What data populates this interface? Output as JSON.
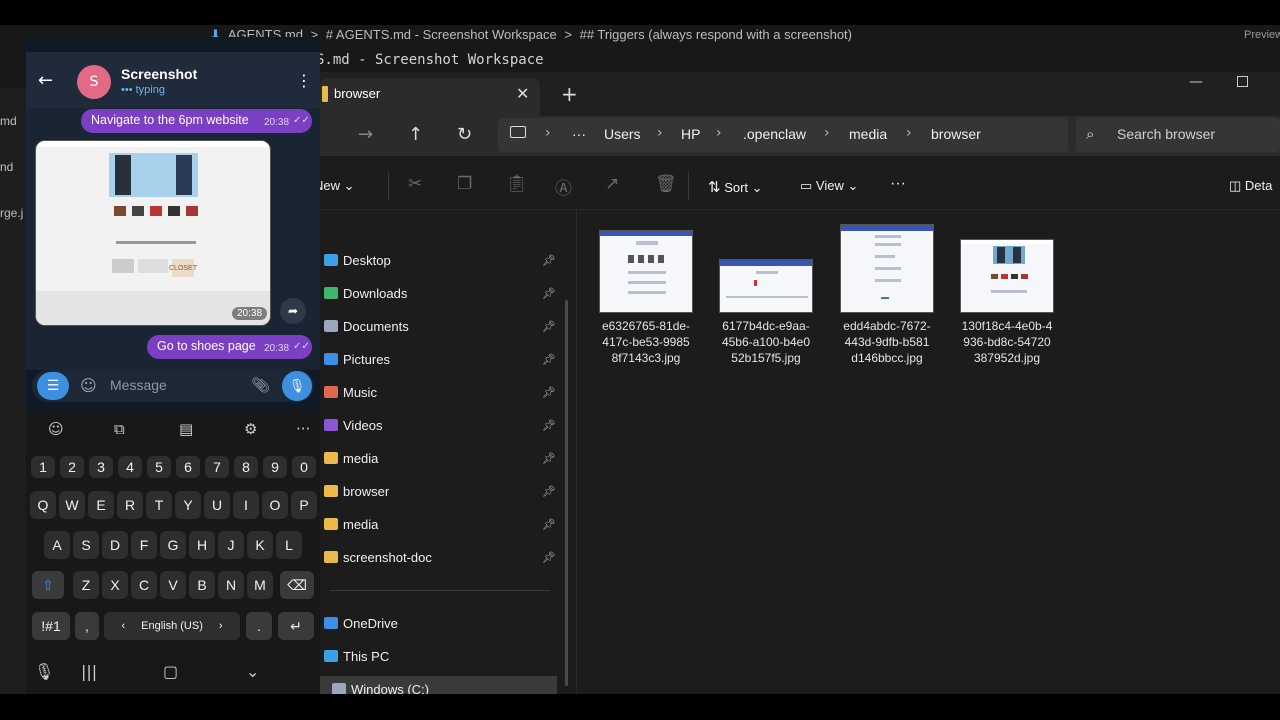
{
  "editor": {
    "breadcrumb": [
      "AGENTS.md",
      ">",
      "# AGENTS.md - Screenshot Workspace",
      ">",
      "## Triggers (always respond with a screenshot)"
    ],
    "preview_label": "Preview",
    "line": "S.md - Screenshot Workspace",
    "left_items": [
      "md",
      "nd",
      "rge.j"
    ]
  },
  "explorer": {
    "tab_title": "browser",
    "path": [
      "Users",
      "HP",
      ".openclaw",
      "media",
      "browser"
    ],
    "search_placeholder": "Search browser",
    "toolbar": {
      "new": "New",
      "sort": "Sort",
      "view": "View",
      "details": "Deta"
    },
    "sidebar": [
      {
        "label": "Desktop",
        "icon": "desktop-icon",
        "color": "#3aa0e8",
        "pinned": true
      },
      {
        "label": "Downloads",
        "icon": "download-icon",
        "color": "#3fb56b",
        "pinned": true
      },
      {
        "label": "Documents",
        "icon": "document-icon",
        "color": "#9aa7bd",
        "pinned": true
      },
      {
        "label": "Pictures",
        "icon": "picture-icon",
        "color": "#3d8ee6",
        "pinned": true
      },
      {
        "label": "Music",
        "icon": "music-icon",
        "color": "#e0684f",
        "pinned": true
      },
      {
        "label": "Videos",
        "icon": "video-icon",
        "color": "#8b57d6",
        "pinned": true
      },
      {
        "label": "media",
        "icon": "folder-icon",
        "color": "#e9b949",
        "pinned": true
      },
      {
        "label": "browser",
        "icon": "folder-icon",
        "color": "#e9b949",
        "pinned": true
      },
      {
        "label": "media",
        "icon": "folder-icon",
        "color": "#e9b949",
        "pinned": true
      },
      {
        "label": "screenshot-doc",
        "icon": "folder-icon",
        "color": "#e9b949",
        "pinned": true
      }
    ],
    "sidebar_lower": [
      {
        "label": "OneDrive",
        "icon": "cloud-icon",
        "color": "#3d8ee6"
      },
      {
        "label": "This PC",
        "icon": "computer-icon",
        "color": "#3aa0e8"
      },
      {
        "label": "Windows (C:)",
        "icon": "drive-icon",
        "color": "#9aa7bd"
      }
    ],
    "files": [
      {
        "line1": "e6326765-81de-",
        "line2": "417c-be53-9985",
        "line3": "8f7143c3.jpg"
      },
      {
        "line1": "6177b4dc-e9aa-",
        "line2": "45b6-a100-b4e0",
        "line3": "52b157f5.jpg"
      },
      {
        "line1": "edd4abdc-7672-",
        "line2": "443d-9dfb-b581",
        "line3": "d146bbcc.jpg"
      },
      {
        "line1": "130f18c4-4e0b-4",
        "line2": "936-bd8c-54720",
        "line3": "387952d.jpg"
      }
    ]
  },
  "telegram": {
    "avatar_letter": "S",
    "chat_name": "Screenshot",
    "status": "••• typing",
    "messages": [
      {
        "text": "Navigate to the 6pm website",
        "time": "20:38"
      },
      {
        "text": "Go to shoes page",
        "time": "20:38"
      }
    ],
    "image_time": "20:38",
    "image_banner": "CLOSET",
    "message_placeholder": "Message",
    "keyboard": {
      "numbers": [
        "1",
        "2",
        "3",
        "4",
        "5",
        "6",
        "7",
        "8",
        "9",
        "0"
      ],
      "row1": [
        "Q",
        "W",
        "E",
        "R",
        "T",
        "Y",
        "U",
        "I",
        "O",
        "P"
      ],
      "row2": [
        "A",
        "S",
        "D",
        "F",
        "G",
        "H",
        "J",
        "K",
        "L"
      ],
      "row3": [
        "Z",
        "X",
        "C",
        "V",
        "B",
        "N",
        "M"
      ],
      "symbols": "!#1",
      "comma": ",",
      "space": "English (US)",
      "period": "."
    }
  },
  "colors": {
    "accent_blue": "#3d8fe0",
    "bubble_purple": "#7b3fc4",
    "folder_yellow": "#e9b949"
  }
}
